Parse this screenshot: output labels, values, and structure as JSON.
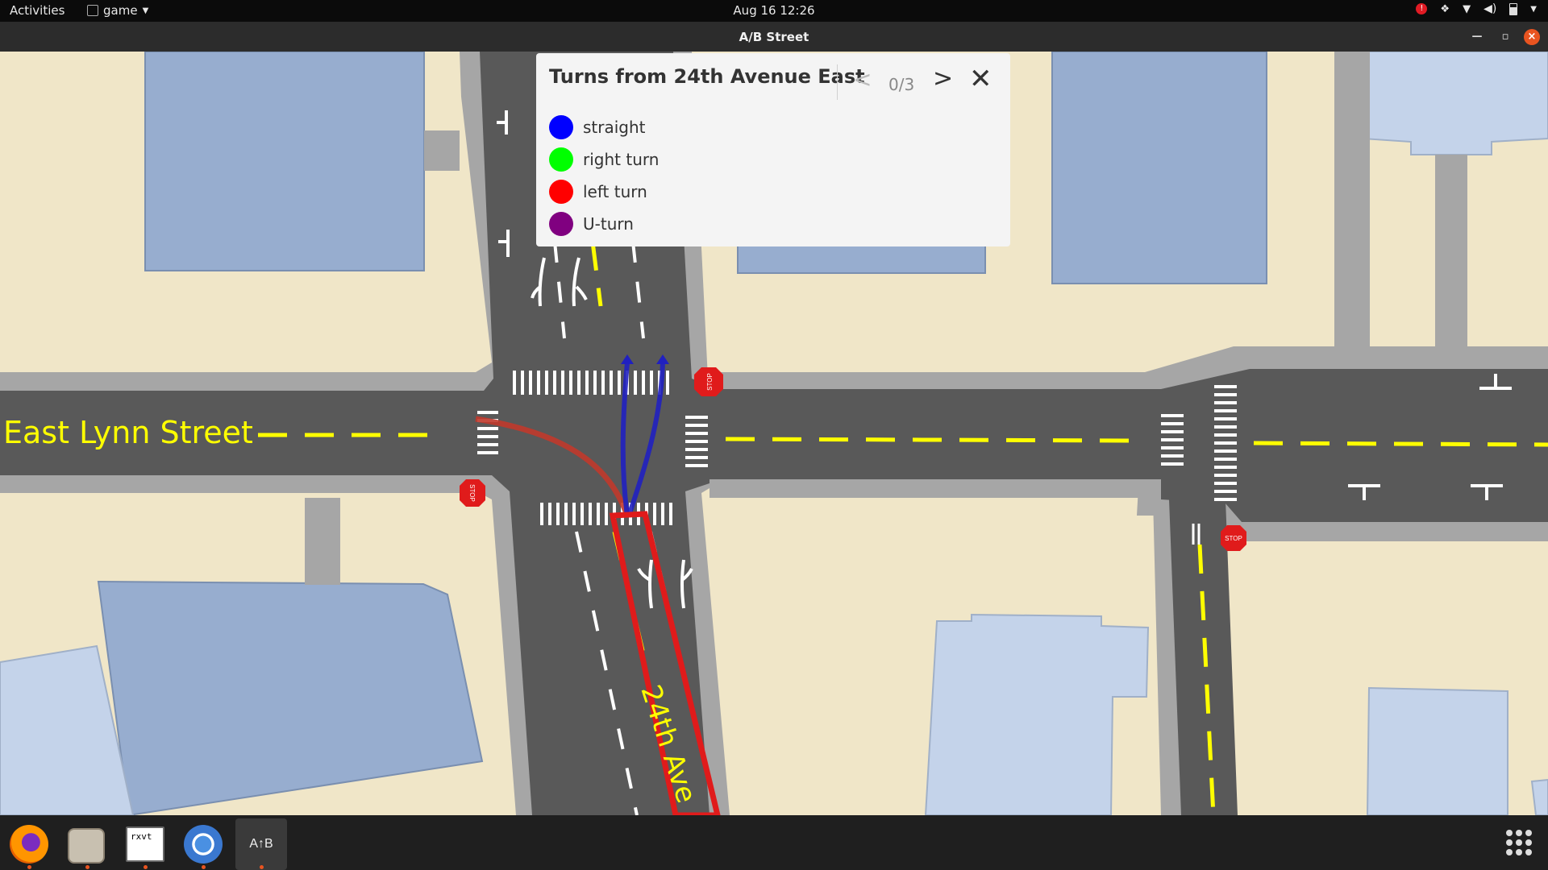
{
  "topbar": {
    "activities": "Activities",
    "app_name": "game",
    "clock": "Aug 16  12:26"
  },
  "window": {
    "title": "A/B Street"
  },
  "map_labels": {
    "street_horizontal": "East Lynn Street",
    "street_vertical": "24th Ave",
    "stop_sign": "STOP"
  },
  "panel": {
    "title": "Turns from 24th Avenue East",
    "counter": "0/3",
    "legend": [
      {
        "label": "straight",
        "color": "#0000ff"
      },
      {
        "label": "right turn",
        "color": "#00ff00"
      },
      {
        "label": "left turn",
        "color": "#ff0000"
      },
      {
        "label": "U-turn",
        "color": "#800080"
      }
    ]
  },
  "dock": {
    "apps": [
      "firefox-icon",
      "files-icon",
      "rxvt-icon",
      "chromium-icon",
      "abstreet-icon"
    ],
    "rxvt_label": "rxvt"
  },
  "colors": {
    "land": "#f0e6c8",
    "road": "#595959",
    "sidewalk": "#a6a6a6",
    "building": "#97adcf",
    "building_light": "#c4d3ea",
    "center_line": "#ffff00",
    "accent": "#e95420"
  }
}
